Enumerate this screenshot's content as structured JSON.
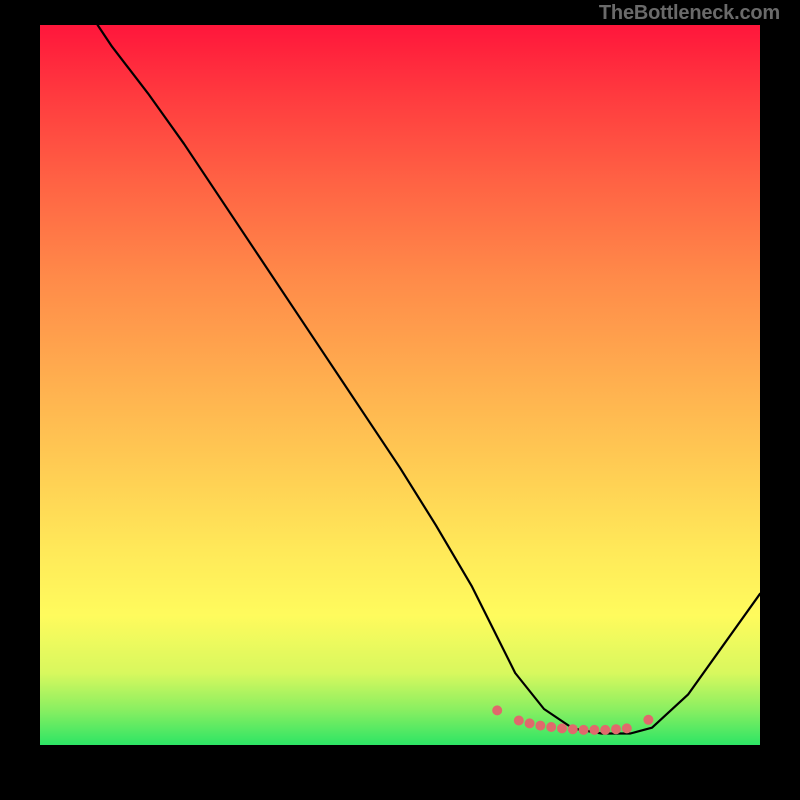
{
  "watermark": "TheBottleneck.com",
  "chart_data": {
    "type": "line",
    "title": "",
    "xlabel": "",
    "ylabel": "",
    "xlim": [
      0,
      100
    ],
    "ylim": [
      0,
      100
    ],
    "series": [
      {
        "name": "bottleneck-curve",
        "x": [
          8,
          10,
          15,
          20,
          25,
          30,
          35,
          40,
          45,
          50,
          55,
          60,
          63,
          66,
          70,
          74,
          78,
          82,
          85,
          90,
          95,
          100
        ],
        "values": [
          100,
          97,
          90.5,
          83.5,
          76,
          68.5,
          61,
          53.5,
          46,
          38.5,
          30.5,
          22,
          16,
          10,
          5,
          2.3,
          1.6,
          1.6,
          2.4,
          7,
          14,
          21
        ]
      }
    ],
    "markers": {
      "name": "optimal-range-markers",
      "color": "#e0696c",
      "x": [
        63.5,
        66.5,
        68.0,
        69.5,
        71.0,
        72.5,
        74.0,
        75.5,
        77.0,
        78.5,
        80.0,
        81.5,
        84.5
      ],
      "values": [
        4.8,
        3.4,
        3.0,
        2.7,
        2.5,
        2.3,
        2.2,
        2.1,
        2.1,
        2.1,
        2.2,
        2.3,
        3.5
      ]
    },
    "gradient": {
      "direction": "vertical",
      "stops": [
        {
          "pos": 0.0,
          "color": "#ff163b"
        },
        {
          "pos": 0.5,
          "color": "#ffb04f"
        },
        {
          "pos": 0.82,
          "color": "#fffb5d"
        },
        {
          "pos": 1.0,
          "color": "#2de565"
        }
      ]
    }
  }
}
